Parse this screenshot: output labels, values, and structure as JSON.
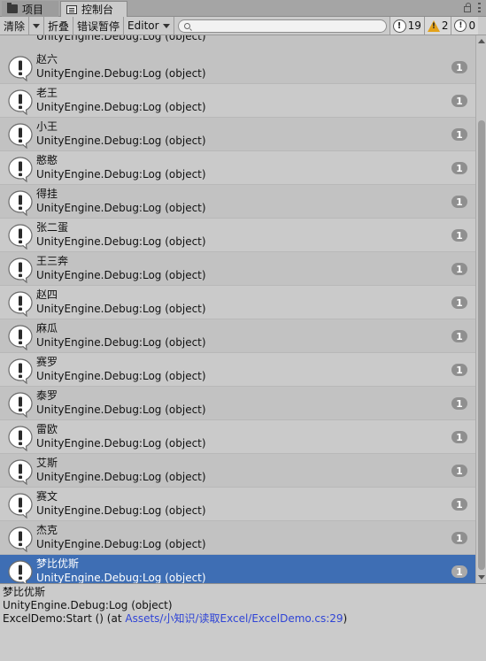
{
  "tabs": [
    {
      "label": "项目",
      "icon": "folder-icon"
    },
    {
      "label": "控制台",
      "icon": "console-icon"
    }
  ],
  "toolbar": {
    "clear_label": "清除",
    "collapse_label": "折叠",
    "error_pause_label": "错误暂停",
    "editor_label": "Editor",
    "search_placeholder": "",
    "info_count": "19",
    "warning_count": "2",
    "error_count": "0"
  },
  "log": {
    "partial_top_stack": "UnityEngine.Debug:Log (object)",
    "entries": [
      {
        "message": "赵六",
        "stack": "UnityEngine.Debug:Log (object)",
        "count": "1"
      },
      {
        "message": "老王",
        "stack": "UnityEngine.Debug:Log (object)",
        "count": "1"
      },
      {
        "message": "小王",
        "stack": "UnityEngine.Debug:Log (object)",
        "count": "1"
      },
      {
        "message": "憨憨",
        "stack": "UnityEngine.Debug:Log (object)",
        "count": "1"
      },
      {
        "message": "得挂",
        "stack": "UnityEngine.Debug:Log (object)",
        "count": "1"
      },
      {
        "message": "张二蛋",
        "stack": "UnityEngine.Debug:Log (object)",
        "count": "1"
      },
      {
        "message": "王三奔",
        "stack": "UnityEngine.Debug:Log (object)",
        "count": "1"
      },
      {
        "message": "赵四",
        "stack": "UnityEngine.Debug:Log (object)",
        "count": "1"
      },
      {
        "message": "麻瓜",
        "stack": "UnityEngine.Debug:Log (object)",
        "count": "1"
      },
      {
        "message": "赛罗",
        "stack": "UnityEngine.Debug:Log (object)",
        "count": "1"
      },
      {
        "message": "泰罗",
        "stack": "UnityEngine.Debug:Log (object)",
        "count": "1"
      },
      {
        "message": "雷欧",
        "stack": "UnityEngine.Debug:Log (object)",
        "count": "1"
      },
      {
        "message": "艾斯",
        "stack": "UnityEngine.Debug:Log (object)",
        "count": "1"
      },
      {
        "message": "赛文",
        "stack": "UnityEngine.Debug:Log (object)",
        "count": "1"
      },
      {
        "message": "杰克",
        "stack": "UnityEngine.Debug:Log (object)",
        "count": "1"
      },
      {
        "message": "梦比优斯",
        "stack": "UnityEngine.Debug:Log (object)",
        "count": "1",
        "selected": true
      }
    ]
  },
  "detail": {
    "line1": "梦比优斯",
    "line2": "UnityEngine.Debug:Log (object)",
    "line3_prefix": "ExcelDemo:Start () (at ",
    "line3_link": "Assets/小知识/读取Excel/ExcelDemo.cs:29",
    "line3_suffix": ")"
  },
  "colors": {
    "selected_row": "#3e6eb4",
    "link": "#2f44d6",
    "warning": "#e3a21a"
  }
}
